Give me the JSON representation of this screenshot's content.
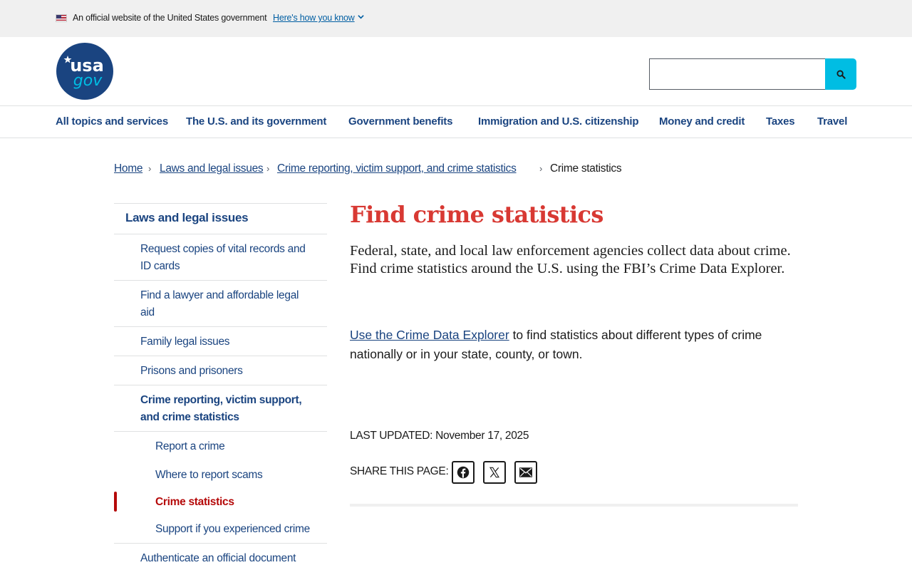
{
  "banner": {
    "text": "An official website of the United States government",
    "link": "Here's how you know"
  },
  "logo": {
    "line1": "usa",
    "line2": "gov"
  },
  "search": {
    "value": "",
    "placeholder": ""
  },
  "nav": [
    "All topics and services",
    "The U.S. and its government",
    "Government benefits",
    "Immigration and U.S. citizenship",
    "Money and credit",
    "Taxes",
    "Travel"
  ],
  "breadcrumb": {
    "home": "Home",
    "laws": "Laws and legal issues",
    "crime": "Crime reporting, victim support, and crime statistics",
    "current": "Crime statistics"
  },
  "sidebar": {
    "heading": "Laws and legal issues",
    "vital_records": "Request copies of vital records and ID cards",
    "lawyer": "Find a lawyer and affordable legal aid",
    "family": "Family legal issues",
    "prisons": "Prisons and prisoners",
    "crime_section": "Crime reporting, victim support, and crime statistics",
    "report_crime": "Report a crime",
    "report_scams": "Where to report scams",
    "crime_stats": "Crime statistics",
    "support": "Support if you experienced crime",
    "authenticate": "Authenticate an official document"
  },
  "main": {
    "title": "Find crime statistics",
    "lead": "Federal, state, and local law enforcement agencies collect data about crime. Find crime statistics around the U.S. using the FBI’s Crime Data Explorer.",
    "link": "Use the Crime Data Explorer",
    "body": " to find statistics about different types of crime nationally or in your state, county, or town.",
    "updated_label": "Last updated:",
    "updated_date": "November 17, 2025",
    "share_label": "Share this page:"
  },
  "colors": {
    "navy": "#1a4480",
    "title_red": "#d83933",
    "current_red": "#b50909",
    "search_cyan": "#00bde3"
  }
}
